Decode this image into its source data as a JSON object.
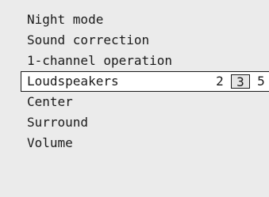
{
  "menu": {
    "items": [
      {
        "label": "Night mode"
      },
      {
        "label": "Sound correction"
      },
      {
        "label": "1-channel operation"
      },
      {
        "label": "Loudspeakers",
        "options": [
          "2",
          "3",
          "5"
        ],
        "selected_option": "3"
      },
      {
        "label": "Center"
      },
      {
        "label": "Surround"
      },
      {
        "label": "Volume"
      }
    ]
  }
}
